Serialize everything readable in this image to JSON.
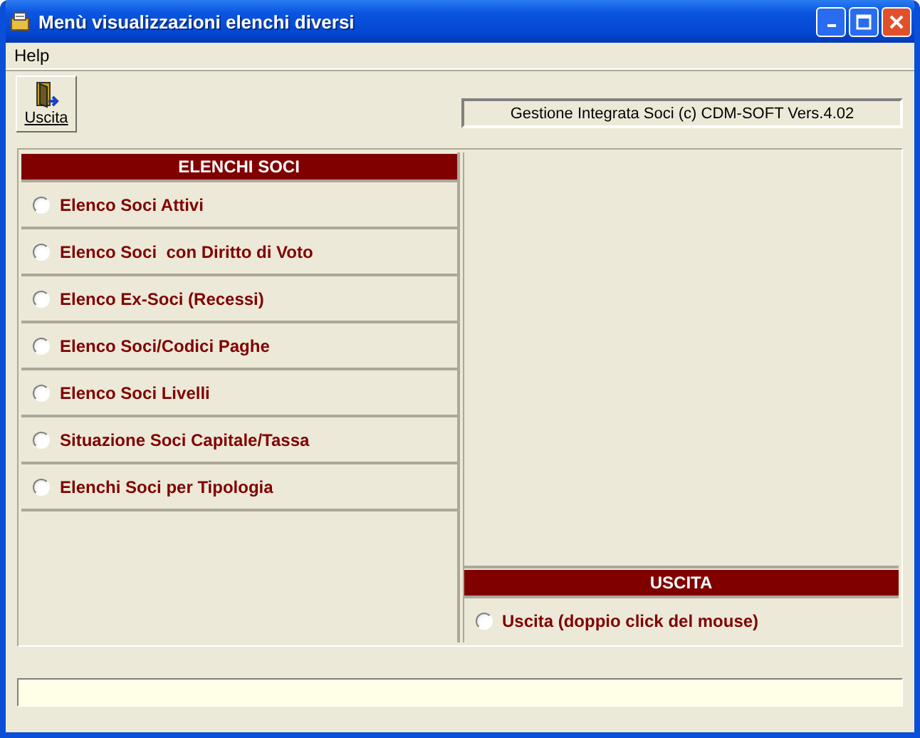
{
  "window": {
    "title": "Menù visualizzazioni elenchi diversi"
  },
  "menu": [
    "Help"
  ],
  "toolbar": {
    "exit_button": "Uscita",
    "info": "Gestione Integrata Soci (c) CDM-SOFT Vers.4.02"
  },
  "left_panel": {
    "heading": "ELENCHI SOCI",
    "options": [
      {
        "label": "Elenco Soci Attivi",
        "selected": false
      },
      {
        "label": "Elenco Soci  con Diritto di Voto",
        "selected": false
      },
      {
        "label": "Elenco Ex-Soci (Recessi)",
        "selected": false
      },
      {
        "label": "Elenco Soci/Codici Paghe",
        "selected": false
      },
      {
        "label": "Elenco Soci Livelli",
        "selected": false
      },
      {
        "label": "Situazione Soci Capitale/Tassa",
        "selected": false
      },
      {
        "label": "Elenchi Soci per Tipologia",
        "selected": false
      }
    ]
  },
  "right_panel": {
    "heading": "USCITA",
    "options": [
      {
        "label": "Uscita (doppio click del mouse)",
        "selected": false
      }
    ]
  }
}
